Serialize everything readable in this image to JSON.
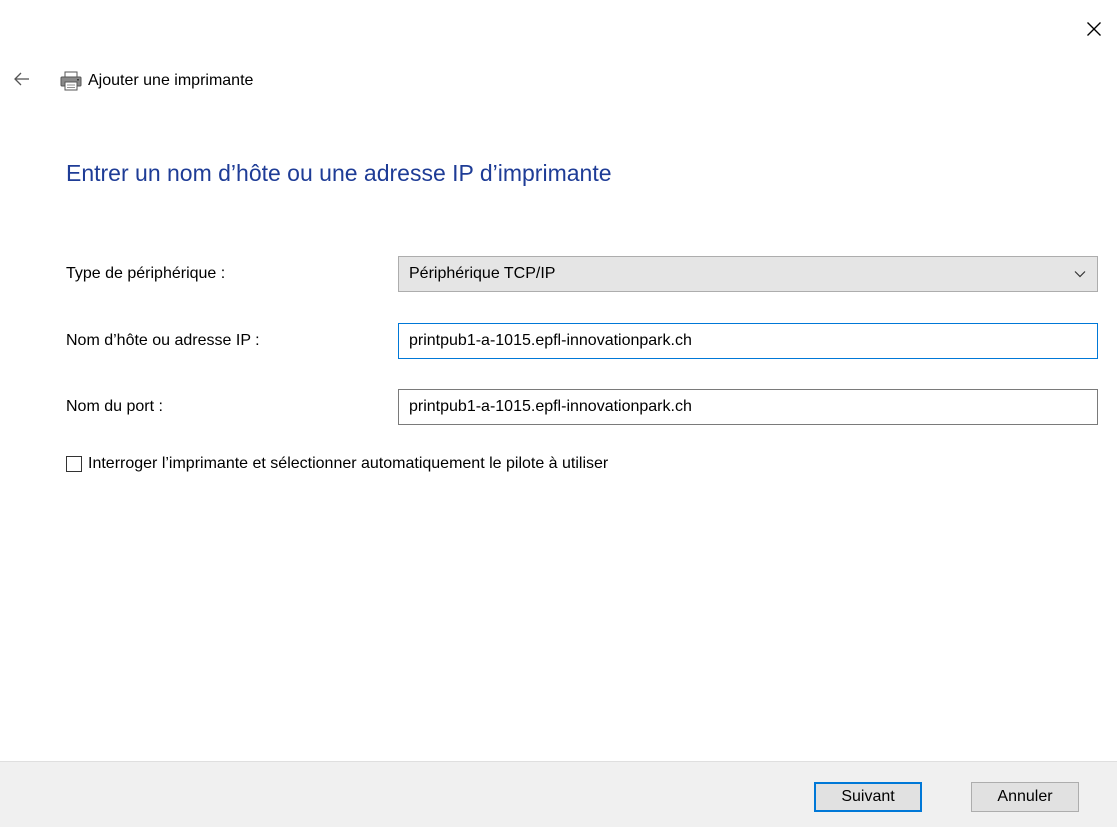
{
  "header": {
    "title": "Ajouter une imprimante"
  },
  "page": {
    "heading": "Entrer un nom d’hôte ou une adresse IP d’imprimante"
  },
  "form": {
    "device_type": {
      "label": "Type de périphérique :",
      "selected": "Périphérique TCP/IP"
    },
    "hostname": {
      "label": "Nom d’hôte ou adresse IP :",
      "value": "printpub1-a-1015.epfl-innovationpark.ch"
    },
    "port": {
      "label": "Nom du port :",
      "value": "printpub1-a-1015.epfl-innovationpark.ch"
    },
    "auto_driver": {
      "label": "Interroger l’imprimante et sélectionner automatiquement le pilote à utiliser",
      "checked": false
    }
  },
  "footer": {
    "next_label": "Suivant",
    "cancel_label": "Annuler"
  },
  "colors": {
    "heading": "#1e3c96",
    "accent": "#0078d7",
    "footer_bg": "#f0f0f0"
  },
  "icons": {
    "close": "close-icon",
    "back": "back-arrow-icon",
    "printer": "printer-icon",
    "dropdown": "chevron-down-icon"
  }
}
